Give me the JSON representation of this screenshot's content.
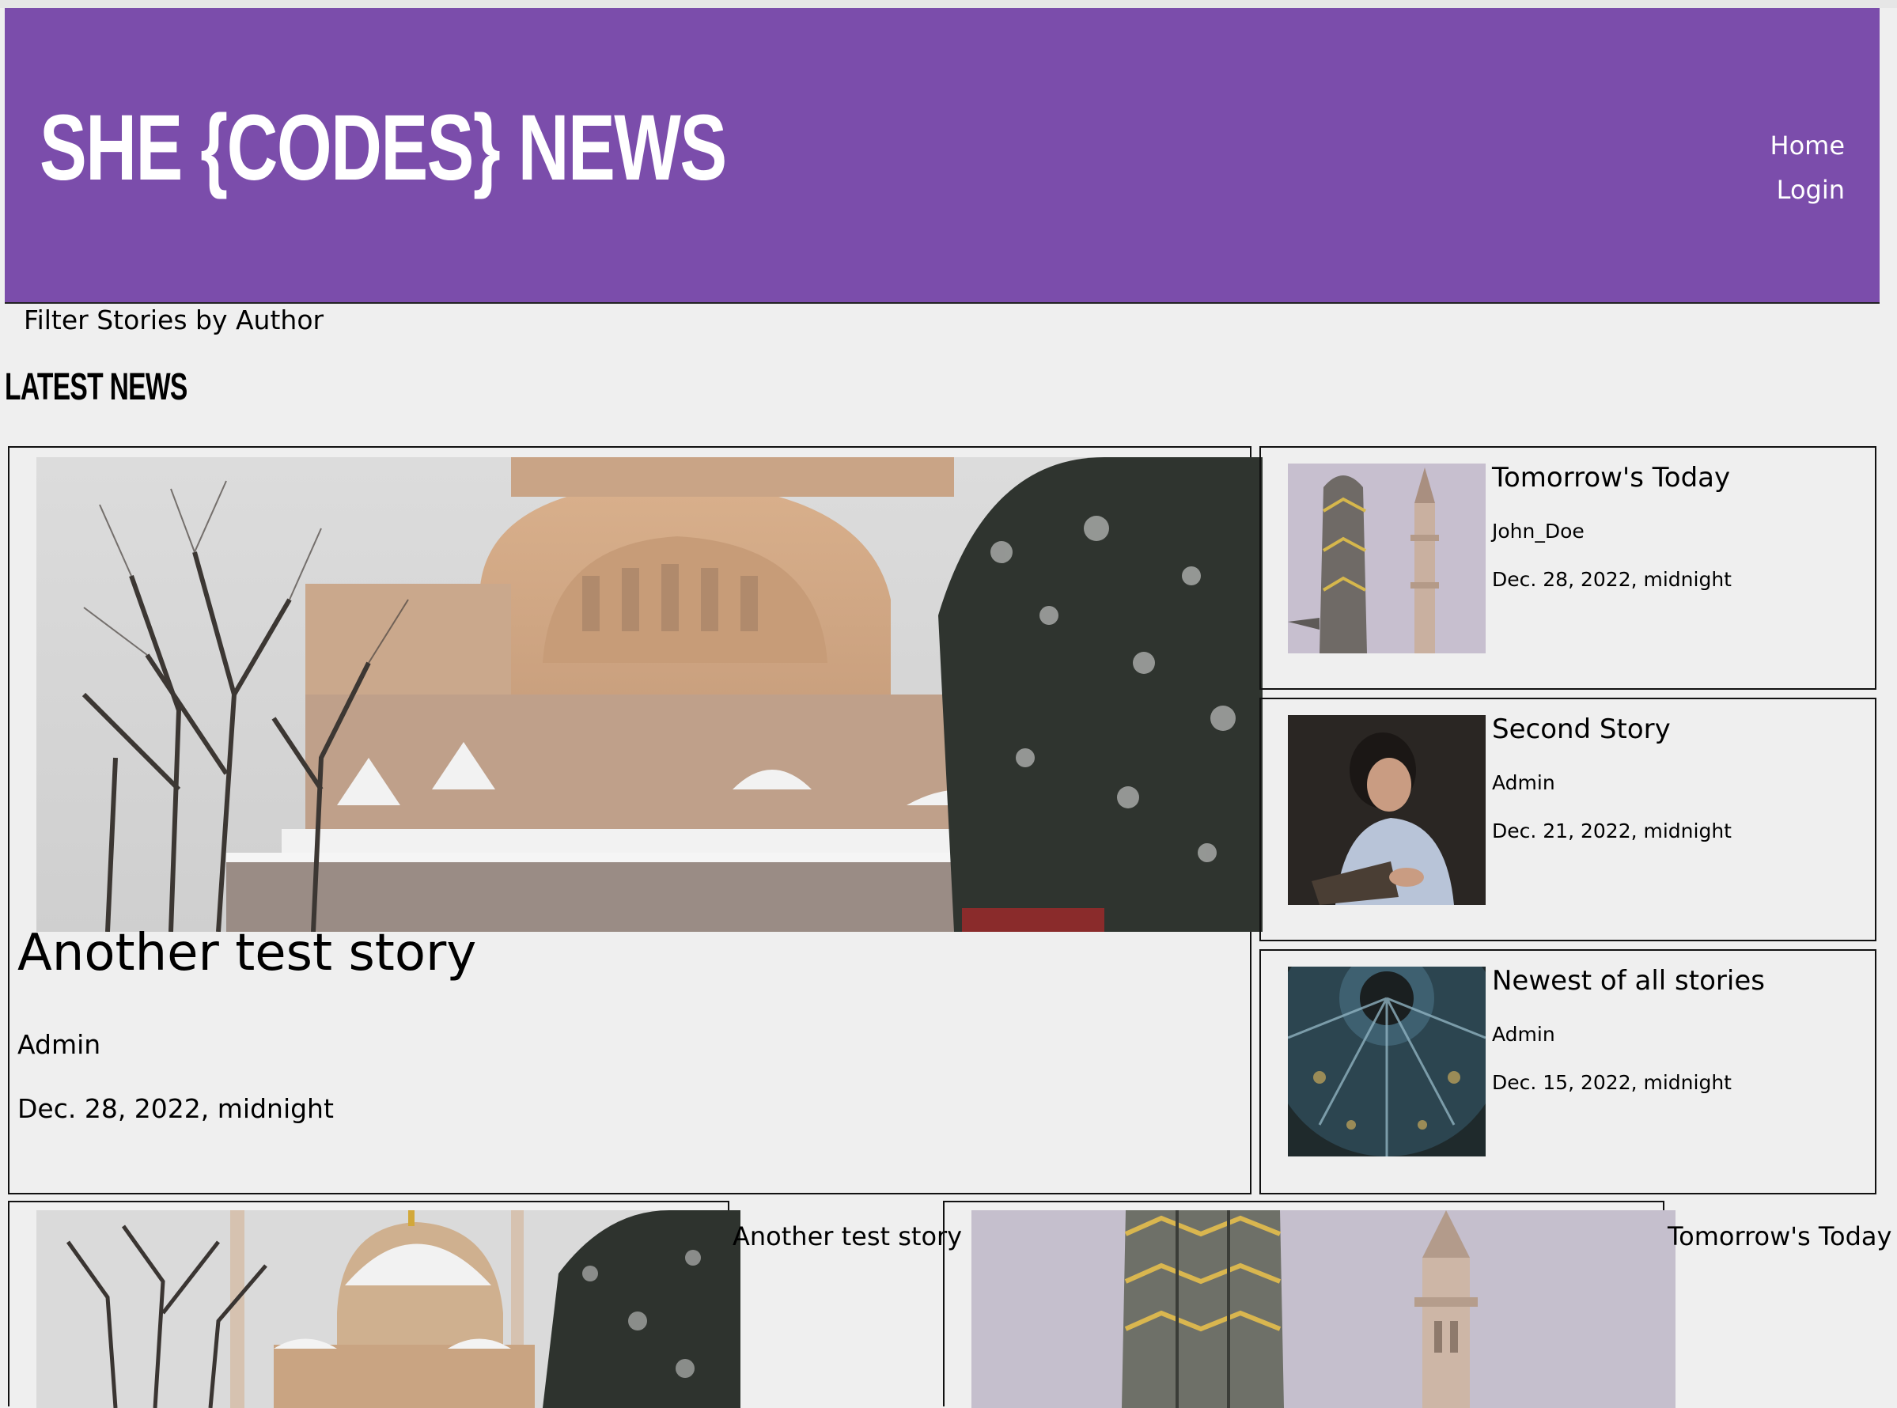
{
  "header": {
    "site_title": "SHE {CODES} NEWS",
    "nav": [
      "Home",
      "Login"
    ],
    "background_color": "#7b4dab"
  },
  "filter_link": "Filter Stories by Author",
  "section_title": "LATEST NEWS",
  "featured_story": {
    "title": "Another test story",
    "author": "Admin",
    "date": "Dec. 28, 2022, midnight",
    "image": "mosque-in-snow"
  },
  "side_stories": [
    {
      "title": "Tomorrow's Today",
      "author": "John_Doe",
      "date": "Dec. 28, 2022, midnight",
      "image": "minaret-towers"
    },
    {
      "title": "Second Story",
      "author": "Admin",
      "date": "Dec. 21, 2022, midnight",
      "image": "woman-reading"
    },
    {
      "title": "Newest of all stories",
      "author": "Admin",
      "date": "Dec. 15, 2022, midnight",
      "image": "ornate-dome"
    }
  ],
  "bottom_stories": [
    {
      "title": "Another test story",
      "image": "mosque-dome-snow"
    },
    {
      "title": "Tomorrow's Today",
      "image": "minaret-towers"
    }
  ]
}
